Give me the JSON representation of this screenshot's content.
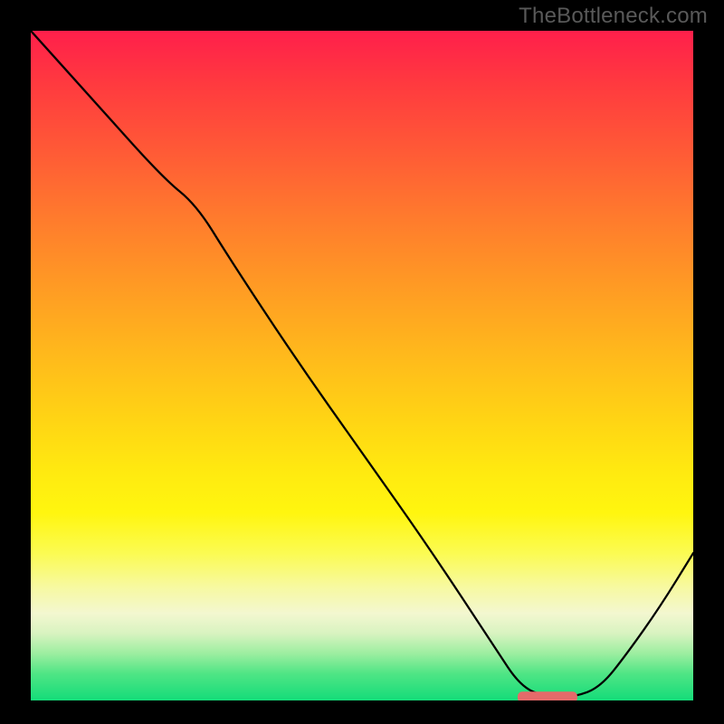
{
  "watermark": "TheBottleneck.com",
  "chart_data": {
    "type": "line",
    "title": "",
    "xlabel": "",
    "ylabel": "",
    "xlim": [
      0,
      100
    ],
    "ylim": [
      0,
      100
    ],
    "grid": false,
    "legend": false,
    "series": [
      {
        "name": "bottleneck-curve",
        "x": [
          0,
          10,
          20,
          25,
          30,
          40,
          50,
          60,
          70,
          74,
          78,
          82,
          86,
          90,
          95,
          100
        ],
        "y": [
          100,
          89,
          78,
          74,
          66,
          51,
          37,
          23,
          8,
          2,
          0.5,
          0.5,
          2,
          7,
          14,
          22
        ]
      }
    ],
    "marker": {
      "x_center": 78,
      "y": 0.5,
      "width_x_units": 9,
      "color": "#e56a6a"
    },
    "background_gradient": {
      "top": "#ff1f4b",
      "middle": "#ffe112",
      "bottom": "#14dc79"
    }
  }
}
